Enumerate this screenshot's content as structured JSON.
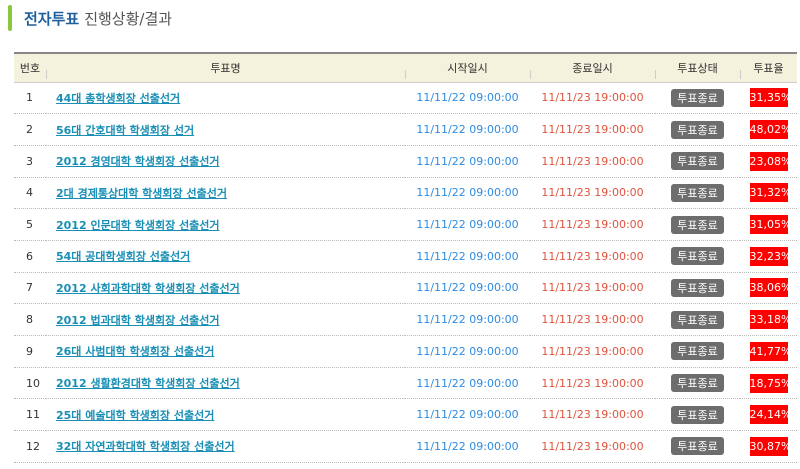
{
  "title": {
    "highlight": "전자투표",
    "rest": "진행상황/결과"
  },
  "columns": [
    "번호",
    "투표명",
    "시작일시",
    "종료일시",
    "투표상태",
    "투표율"
  ],
  "rows": [
    {
      "no": "1",
      "name": "44대 총학생회장 선출선거",
      "start": "11/11/22 09:00:00",
      "end": "11/11/23 19:00:00",
      "status": "투표종료",
      "rate": "31,35%"
    },
    {
      "no": "2",
      "name": "56대 간호대학 학생회장 선거",
      "start": "11/11/22 09:00:00",
      "end": "11/11/23 19:00:00",
      "status": "투표종료",
      "rate": "48,02%"
    },
    {
      "no": "3",
      "name": "2012 경영대학 학생회장 선출선거",
      "start": "11/11/22 09:00:00",
      "end": "11/11/23 19:00:00",
      "status": "투표종료",
      "rate": "23,08%"
    },
    {
      "no": "4",
      "name": "2대 경제통상대학 학생회장 선출선거",
      "start": "11/11/22 09:00:00",
      "end": "11/11/23 19:00:00",
      "status": "투표종료",
      "rate": "31,32%"
    },
    {
      "no": "5",
      "name": "2012 인문대학 학생회장 선출선거",
      "start": "11/11/22 09:00:00",
      "end": "11/11/23 19:00:00",
      "status": "투표종료",
      "rate": "31,05%"
    },
    {
      "no": "6",
      "name": "54대 공대학생회장 선출선거",
      "start": "11/11/22 09:00:00",
      "end": "11/11/23 19:00:00",
      "status": "투표종료",
      "rate": "32,23%"
    },
    {
      "no": "7",
      "name": "2012 사회과학대학 학생회장 선출선거",
      "start": "11/11/22 09:00:00",
      "end": "11/11/23 19:00:00",
      "status": "투표종료",
      "rate": "38,06%"
    },
    {
      "no": "8",
      "name": "2012 법과대학 학생회장 선출선거",
      "start": "11/11/22 09:00:00",
      "end": "11/11/23 19:00:00",
      "status": "투표종료",
      "rate": "33,18%"
    },
    {
      "no": "9",
      "name": "26대 사범대학 학생회장 선출선거",
      "start": "11/11/22 09:00:00",
      "end": "11/11/23 19:00:00",
      "status": "투표종료",
      "rate": "41,77%"
    },
    {
      "no": "10",
      "name": "2012 생활환경대학 학생회장 선출선거",
      "start": "11/11/22 09:00:00",
      "end": "11/11/23 19:00:00",
      "status": "투표종료",
      "rate": "18,75%"
    },
    {
      "no": "11",
      "name": "25대 예술대학 학생회장 선출선거",
      "start": "11/11/22 09:00:00",
      "end": "11/11/23 19:00:00",
      "status": "투표종료",
      "rate": "24,14%"
    },
    {
      "no": "12",
      "name": "32대 자연과학대학 학생회장 선출선거",
      "start": "11/11/22 09:00:00",
      "end": "11/11/23 19:00:00",
      "status": "투표종료",
      "rate": "30,87%"
    }
  ]
}
